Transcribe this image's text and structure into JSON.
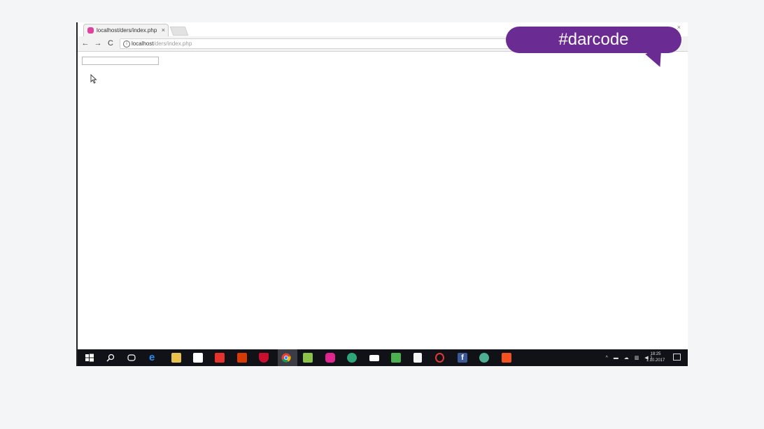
{
  "browser": {
    "tab_title": "localhost/ders/index.php",
    "tab_close": "×",
    "window_close": "×",
    "nav": {
      "back": "←",
      "forward": "→",
      "reload": "C"
    },
    "address": {
      "host": "localhost",
      "path": "/ders/index.php",
      "info_icon": "i"
    }
  },
  "page": {
    "input_value": ""
  },
  "taskbar": {
    "icons": [
      "start-icon",
      "search-icon",
      "task-view-icon",
      "edge-icon",
      "file-explorer-icon",
      "store-icon",
      "todo-icon",
      "office-icon",
      "mcafee-icon",
      "chrome-icon",
      "notepad-icon",
      "app-pink-icon",
      "app-green-icon",
      "mail-icon",
      "camtasia-icon",
      "app-doc-icon",
      "opera-icon",
      "facebook-icon",
      "app-teal-icon",
      "app-orange-icon"
    ],
    "tray_icons": "^ ▬ ☁ ▥ ◀)",
    "clock_time": "18:25",
    "clock_date": "1.10.2017"
  },
  "overlay": {
    "bubble_text": "#darcode",
    "bubble_color": "#6a2b93"
  }
}
